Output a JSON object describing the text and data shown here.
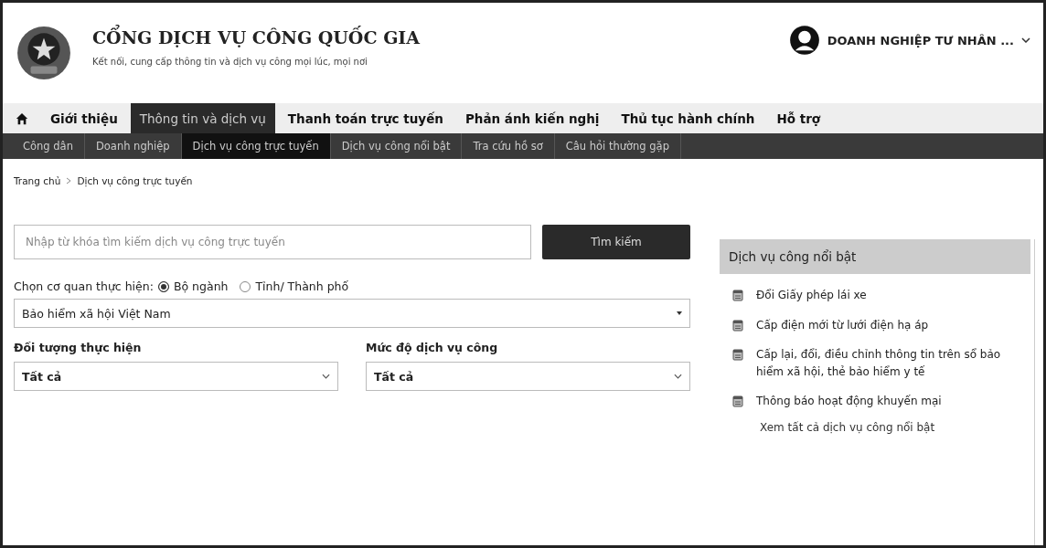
{
  "header": {
    "title": "CỔNG DỊCH VỤ CÔNG QUỐC GIA",
    "subtitle": "Kết nối, cung cấp thông tin và dịch vụ công mọi lúc, mọi nơi",
    "user": "DOANH NGHIỆP TƯ NHÂN ..."
  },
  "main_nav": [
    {
      "label": "Giới thiệu",
      "selected": false
    },
    {
      "label": "Thông tin và dịch vụ",
      "selected": true
    },
    {
      "label": "Thanh toán trực tuyến",
      "selected": false
    },
    {
      "label": "Phản ánh kiến nghị",
      "selected": false
    },
    {
      "label": "Thủ tục hành chính",
      "selected": false
    },
    {
      "label": "Hỗ trợ",
      "selected": false
    }
  ],
  "sub_nav": [
    {
      "label": "Công dân",
      "selected": false
    },
    {
      "label": "Doanh nghiệp",
      "selected": false
    },
    {
      "label": "Dịch vụ công trực tuyến",
      "selected": true
    },
    {
      "label": "Dịch vụ công nổi bật",
      "selected": false
    },
    {
      "label": "Tra cứu hồ sơ",
      "selected": false
    },
    {
      "label": "Câu hỏi thường gặp",
      "selected": false
    }
  ],
  "breadcrumb": [
    "Trang chủ",
    "Dịch vụ công trực tuyến"
  ],
  "search": {
    "placeholder": "Nhập từ khóa tìm kiếm dịch vụ công trực tuyến",
    "button": "Tìm kiếm"
  },
  "agency": {
    "label": "Chọn cơ quan thực hiện:",
    "options": [
      {
        "label": "Bộ ngành",
        "selected": true
      },
      {
        "label": "Tỉnh/ Thành phố",
        "selected": false
      }
    ],
    "value": "Bảo hiểm xã hội Việt Nam"
  },
  "filters": [
    {
      "label": "Đối tượng thực hiện",
      "value": "Tất cả"
    },
    {
      "label": "Mức độ dịch vụ công",
      "value": "Tất cả"
    }
  ],
  "featured": {
    "title": "Dịch vụ công nổi bật",
    "items": [
      "Đổi Giấy phép lái xe",
      "Cấp điện mới từ lưới điện hạ áp",
      "Cấp lại, đổi, điều chỉnh thông tin trên sổ bảo hiểm xã hội, thẻ bảo hiểm y tế",
      "Thông báo hoạt động khuyến mại"
    ],
    "more": "Xem tất cả dịch vụ công nổi bật"
  }
}
